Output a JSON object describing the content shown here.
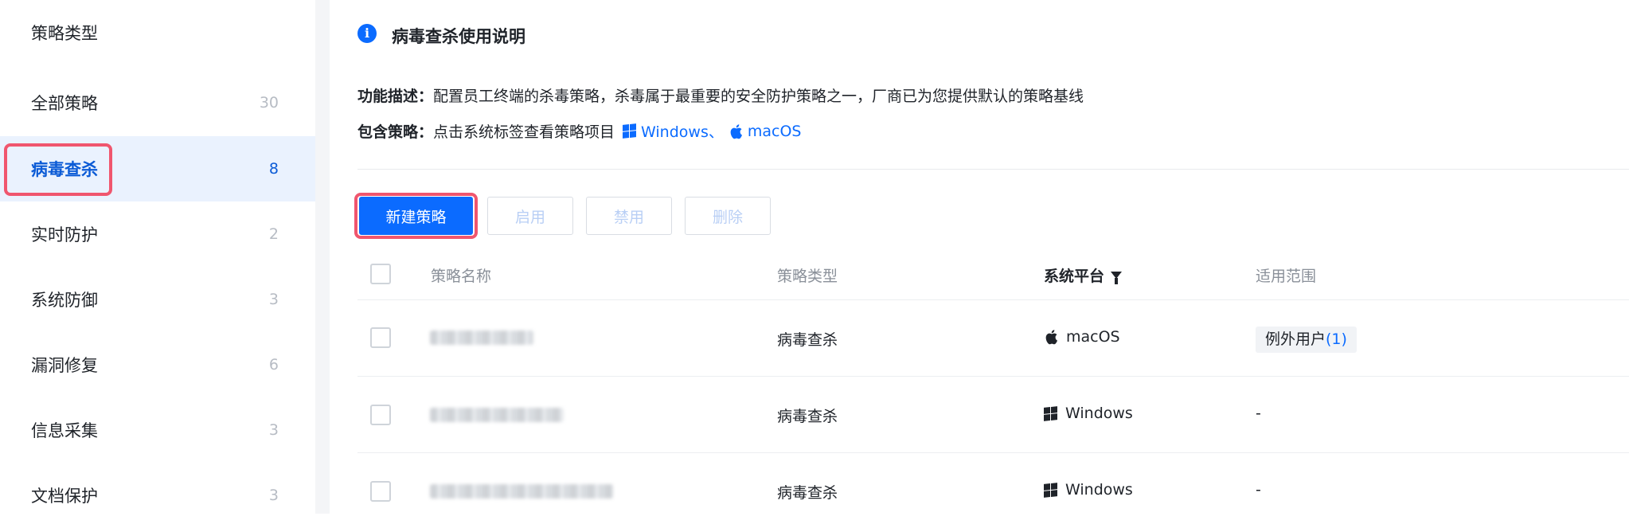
{
  "sidebar": {
    "title": "策略类型",
    "items": [
      {
        "label": "全部策略",
        "count": "30"
      },
      {
        "label": "病毒查杀",
        "count": "8"
      },
      {
        "label": "实时防护",
        "count": "2"
      },
      {
        "label": "系统防御",
        "count": "3"
      },
      {
        "label": "漏洞修复",
        "count": "6"
      },
      {
        "label": "信息采集",
        "count": "3"
      },
      {
        "label": "文档保护",
        "count": "3"
      }
    ],
    "active_index": 1
  },
  "section": {
    "title": "病毒查杀使用说明",
    "desc_label": "功能描述：",
    "desc_text": "配置员工终端的杀毒策略，杀毒属于最重要的安全防护策略之一，厂商已为您提供默认的策略基线",
    "include_label": "包含策略：",
    "include_text": "点击系统标签查看策略项目",
    "os_windows": "Windows、",
    "os_mac": "macOS"
  },
  "toolbar": {
    "new_label": "新建策略",
    "enable_label": "启用",
    "disable_label": "禁用",
    "delete_label": "删除"
  },
  "table": {
    "headers": {
      "name": "策略名称",
      "type": "策略类型",
      "platform": "系统平台",
      "scope": "适用范围"
    },
    "rows": [
      {
        "type": "病毒查杀",
        "platform": "macOS",
        "platform_icon": "apple-icon",
        "scope_tag": "例外用户",
        "scope_count": "(1)"
      },
      {
        "type": "病毒查杀",
        "platform": "Windows",
        "platform_icon": "windows-icon",
        "scope": "-"
      },
      {
        "type": "病毒查杀",
        "platform": "Windows",
        "platform_icon": "windows-icon",
        "scope": "-"
      }
    ]
  },
  "colors": {
    "accent": "#0b6bff",
    "highlight_outline": "#f0566e",
    "active_bg": "#eaf2fe"
  }
}
